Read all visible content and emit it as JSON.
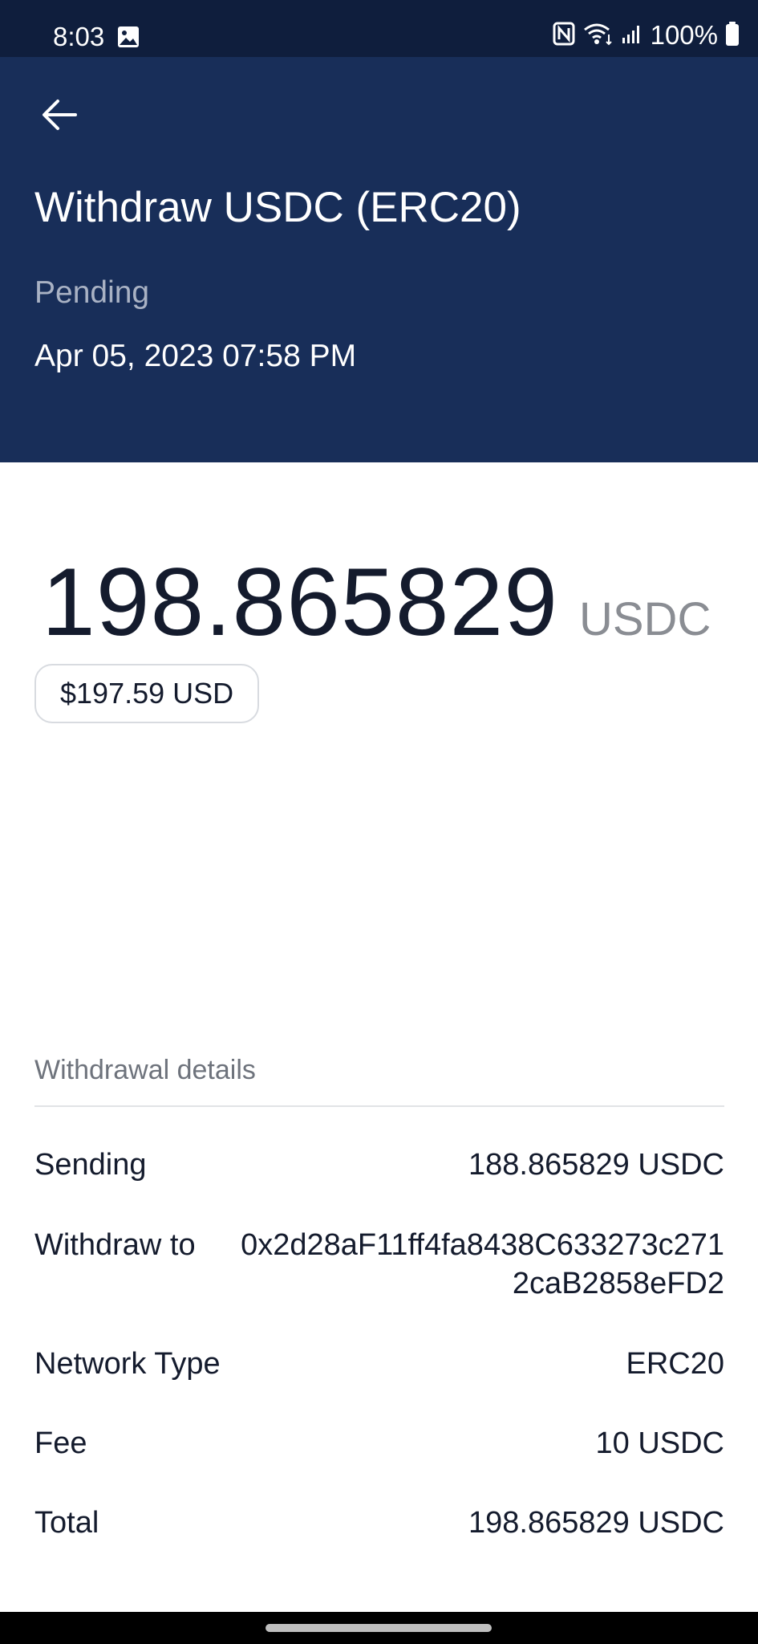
{
  "status_bar": {
    "time": "8:03",
    "battery": "100%",
    "icons": [
      "gallery-icon",
      "nfc-icon",
      "wifi-icon",
      "signal-icon",
      "battery-icon"
    ]
  },
  "header": {
    "back_icon": "arrow-left-icon",
    "title": "Withdraw USDC (ERC20)",
    "status": "Pending",
    "date": "Apr 05, 2023 07:58 PM",
    "background": "#182e59"
  },
  "amount": {
    "value": "198.865829",
    "unit": "USDC",
    "usd": "$197.59 USD"
  },
  "details": {
    "heading": "Withdrawal details",
    "rows": [
      {
        "label": "Sending",
        "value": "188.865829 USDC"
      },
      {
        "label": "Withdraw to",
        "value": "0x2d28aF11ff4fa8438C633273c2712caB2858eFD2"
      },
      {
        "label": "Network Type",
        "value": "ERC20"
      },
      {
        "label": "Fee",
        "value": "10 USDC"
      },
      {
        "label": "Total",
        "value": "198.865829 USDC"
      }
    ]
  }
}
